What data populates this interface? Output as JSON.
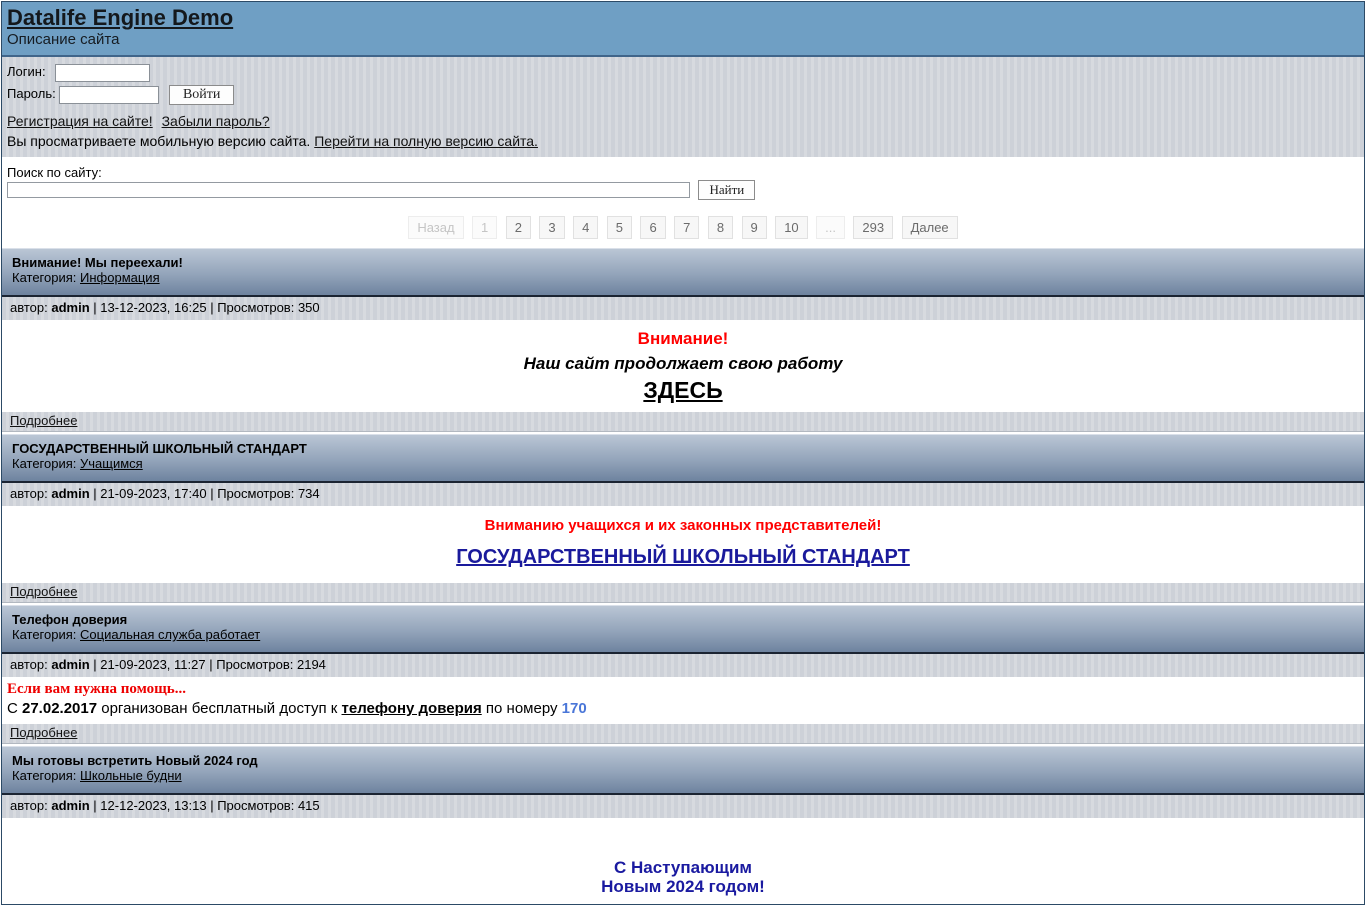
{
  "header": {
    "title": "Datalife Engine Demo",
    "subtitle": "Описание сайта",
    "bg_color": "#6f9fc4"
  },
  "login": {
    "login_label": "Логин:",
    "password_label": "Пароль:",
    "login_value": "",
    "password_value": "",
    "submit_label": "Войти",
    "register_link": "Регистрация на сайте!",
    "forgot_link": "Забыли пароль?",
    "mobile_note": "Вы просматриваете мобильную версию сайта.",
    "full_version_link": "Перейти на полную версию сайта."
  },
  "search": {
    "label": "Поиск по сайту:",
    "value": "",
    "button_label": "Найти"
  },
  "pagination": {
    "items": [
      {
        "label": "Назад",
        "state": "disabled"
      },
      {
        "label": "1",
        "state": "current"
      },
      {
        "label": "2",
        "state": "link"
      },
      {
        "label": "3",
        "state": "link"
      },
      {
        "label": "4",
        "state": "link"
      },
      {
        "label": "5",
        "state": "link"
      },
      {
        "label": "6",
        "state": "link"
      },
      {
        "label": "7",
        "state": "link"
      },
      {
        "label": "8",
        "state": "link"
      },
      {
        "label": "9",
        "state": "link"
      },
      {
        "label": "10",
        "state": "link"
      },
      {
        "label": "...",
        "state": "disabled"
      },
      {
        "label": "293",
        "state": "link"
      },
      {
        "label": "Далее",
        "state": "link"
      }
    ]
  },
  "labels": {
    "category": "Категория:",
    "author": "автор:",
    "views": "Просмотров:",
    "sep": "|",
    "more": "Подробнее"
  },
  "news": [
    {
      "title": "Внимание! Мы переехали!",
      "category": "Информация",
      "author": "admin",
      "date": "13-12-2023, 16:25",
      "views": "350",
      "body": {
        "line1": "Внимание!",
        "line2": "Наш сайт продолжает свою работу",
        "link": "ЗДЕСЬ"
      }
    },
    {
      "title": "ГОСУДАРСТВЕННЫЙ ШКОЛЬНЫЙ СТАНДАРТ",
      "category": "Учащимся",
      "author": "admin",
      "date": "21-09-2023, 17:40",
      "views": "734",
      "body": {
        "line1": "Вниманию учащихся и их законных представителей!",
        "link": "ГОСУДАРСТВЕННЫЙ ШКОЛЬНЫЙ СТАНДАРТ"
      }
    },
    {
      "title": "Телефон доверия",
      "category": "Социальная служба работает",
      "author": "admin",
      "date": "21-09-2023, 11:27",
      "views": "2194",
      "body": {
        "line1": "Если вам нужна помощь...",
        "seg_prefix": "С ",
        "seg_date": "27.02.2017",
        "seg_mid": " организован бесплатный доступ к ",
        "seg_link": "телефону доверия",
        "seg_mid2": " по номеру ",
        "seg_number": "170"
      }
    },
    {
      "title": "Мы готовы встретить Новый 2024 год",
      "category": "Школьные будни",
      "author": "admin",
      "date": "12-12-2023, 13:13",
      "views": "415",
      "body": {
        "line1": "С Наступающим",
        "line2": "Новым 2024 годом!"
      }
    }
  ],
  "colors": {
    "header_blue": "#6f9fc4",
    "title_bar_gradient_top": "#bac6d5",
    "title_bar_gradient_bottom": "#6e839f",
    "stripe_dark": "#cdd1d8",
    "stripe_light": "#d7dadf",
    "attention_red": "#ff0000",
    "navy_link": "#1a1a9c",
    "phone_number_blue": "#4a76d8"
  }
}
